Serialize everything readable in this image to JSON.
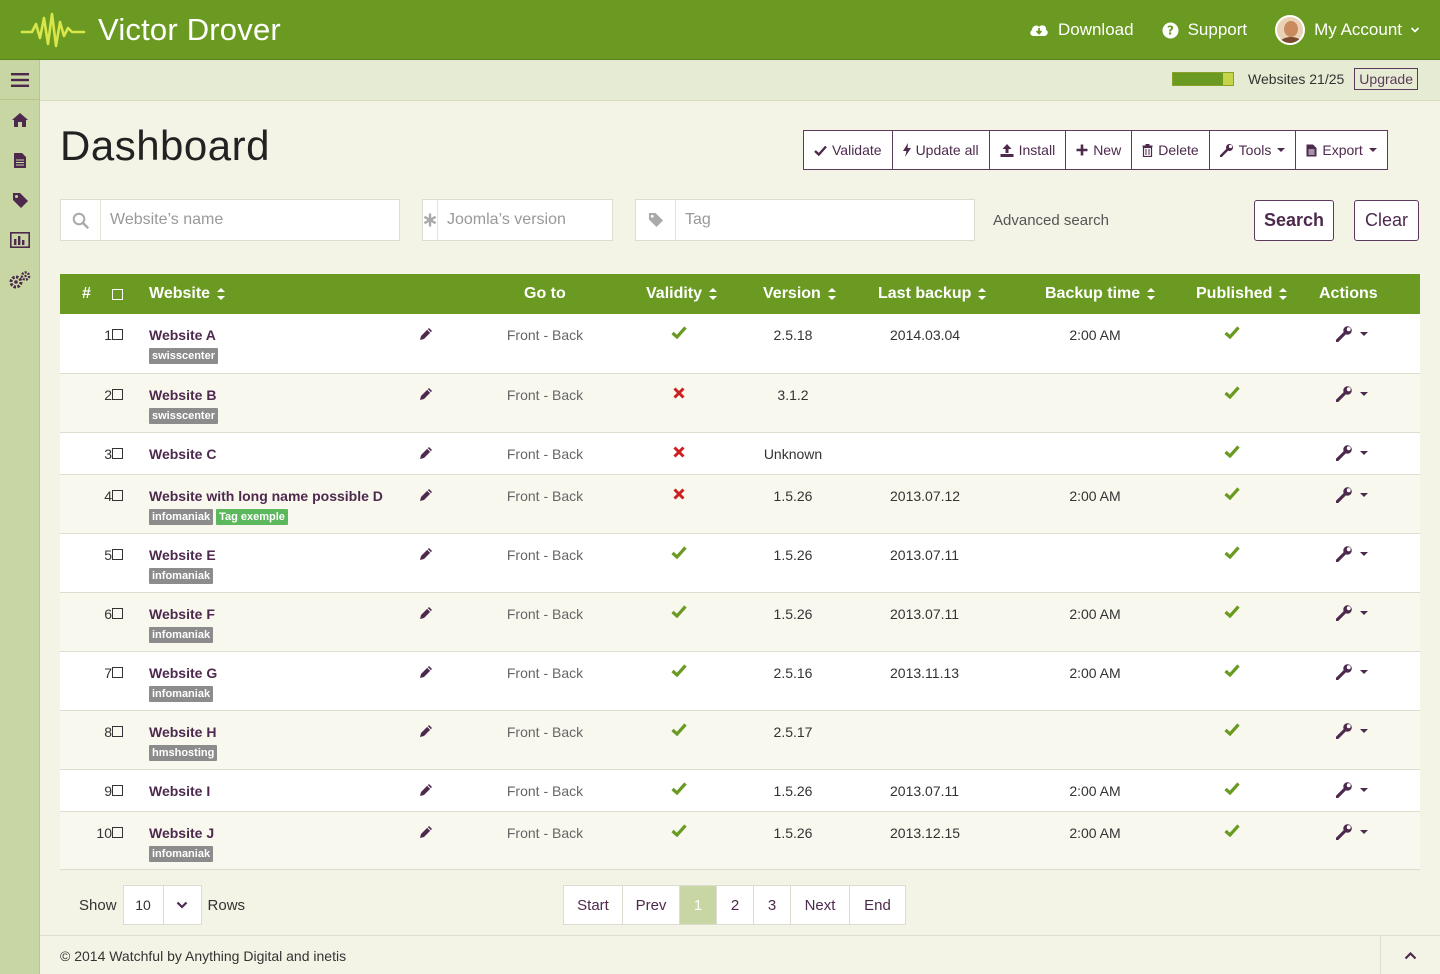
{
  "header": {
    "brand": "Victor Drover",
    "download": "Download",
    "support": "Support",
    "account": "My Account"
  },
  "sidebar": {
    "items": [
      {
        "icon": "hamburger-menu-icon"
      },
      {
        "icon": "home-icon"
      },
      {
        "icon": "document-icon"
      },
      {
        "icon": "tag-icon"
      },
      {
        "icon": "bar-chart-icon"
      },
      {
        "icon": "gears-icon"
      }
    ]
  },
  "quota": {
    "label": "Websites 21/25",
    "fraction": 0.84,
    "upgrade": "Upgrade"
  },
  "page": {
    "title": "Dashboard"
  },
  "toolbar": {
    "validate": "Validate",
    "update_all": "Update all",
    "install": "Install",
    "new": "New",
    "delete": "Delete",
    "tools": "Tools",
    "export": "Export"
  },
  "search": {
    "website_placeholder": "Website’s name",
    "joomla_placeholder": "Joomla’s version",
    "tag_placeholder": "Tag",
    "advanced": "Advanced search",
    "search_button": "Search",
    "clear_button": "Clear"
  },
  "table": {
    "headers": {
      "num": "#",
      "website": "Website",
      "goto": "Go to",
      "validity": "Validity",
      "version": "Version",
      "last_backup": "Last backup",
      "backup_time": "Backup time",
      "published": "Published",
      "actions": "Actions"
    },
    "goto_text": "Front - Back",
    "rows": [
      {
        "num": "1",
        "name": "Website A",
        "tags": [
          {
            "label": "swisscenter",
            "color": "#8c8c8c"
          }
        ],
        "valid": true,
        "version": "2.5.18",
        "backup": "2014.03.04",
        "btime": "2:00 AM",
        "published": true
      },
      {
        "num": "2",
        "name": "Website B",
        "tags": [
          {
            "label": "swisscenter",
            "color": "#8c8c8c"
          }
        ],
        "valid": false,
        "version": "3.1.2",
        "backup": "",
        "btime": "",
        "published": true
      },
      {
        "num": "3",
        "name": "Website C",
        "tags": [],
        "valid": false,
        "version": "Unknown",
        "backup": "",
        "btime": "",
        "published": true
      },
      {
        "num": "4",
        "name": "Website with long name possible D",
        "tags": [
          {
            "label": "infomaniak",
            "color": "#8c8c8c"
          },
          {
            "label": "Tag exemple",
            "color": "#5cb85c"
          }
        ],
        "valid": false,
        "version": "1.5.26",
        "backup": "2013.07.12",
        "btime": "2:00 AM",
        "published": true
      },
      {
        "num": "5",
        "name": "Website E",
        "tags": [
          {
            "label": "infomaniak",
            "color": "#8c8c8c"
          }
        ],
        "valid": true,
        "version": "1.5.26",
        "backup": "2013.07.11",
        "btime": "",
        "published": true
      },
      {
        "num": "6",
        "name": "Website F",
        "tags": [
          {
            "label": "infomaniak",
            "color": "#8c8c8c"
          }
        ],
        "valid": true,
        "version": "1.5.26",
        "backup": "2013.07.11",
        "btime": "2:00 AM",
        "published": true
      },
      {
        "num": "7",
        "name": "Website G",
        "tags": [
          {
            "label": "infomaniak",
            "color": "#8c8c8c"
          }
        ],
        "valid": true,
        "version": "2.5.16",
        "backup": "2013.11.13",
        "btime": "2:00 AM",
        "published": true
      },
      {
        "num": "8",
        "name": "Website H",
        "tags": [
          {
            "label": "hmshosting",
            "color": "#8c8c8c"
          }
        ],
        "valid": true,
        "version": "2.5.17",
        "backup": "",
        "btime": "",
        "published": true
      },
      {
        "num": "9",
        "name": "Website I",
        "tags": [],
        "valid": true,
        "version": "1.5.26",
        "backup": "2013.07.11",
        "btime": "2:00 AM",
        "published": true
      },
      {
        "num": "10",
        "name": "Website J",
        "tags": [
          {
            "label": "infomaniak",
            "color": "#8c8c8c"
          }
        ],
        "valid": true,
        "version": "1.5.26",
        "backup": "2013.12.15",
        "btime": "2:00 AM",
        "published": true
      }
    ]
  },
  "pagination": {
    "show": "Show",
    "rows_value": "10",
    "rows_label": "Rows",
    "start": "Start",
    "prev": "Prev",
    "pages": [
      "1",
      "2",
      "3"
    ],
    "active_page": "1",
    "next": "Next",
    "end": "End"
  },
  "footer": {
    "copyright": "© 2014 Watchful by Anything Digital and inetis"
  },
  "colors": {
    "brand_green": "#6b9a22",
    "accent_purple": "#4d2a4d",
    "check_green": "#6b9a22",
    "cross_red": "#cc1f1f"
  }
}
